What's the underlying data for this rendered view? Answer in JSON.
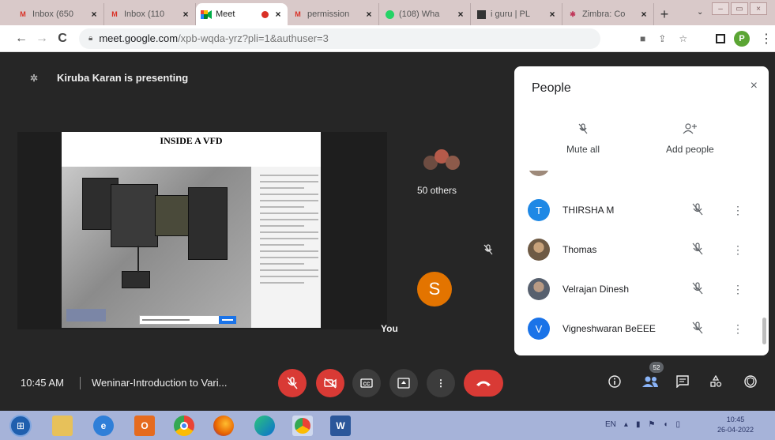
{
  "browser": {
    "tabs": [
      {
        "title": "Inbox (650",
        "favicon": "gmail-icon"
      },
      {
        "title": "Inbox (110",
        "favicon": "gmail-icon"
      },
      {
        "title": "Meet",
        "favicon": "meet-icon",
        "active": true,
        "recording": true
      },
      {
        "title": "permission",
        "favicon": "gmail-icon"
      },
      {
        "title": "(108) Wha",
        "favicon": "whatsapp-icon"
      },
      {
        "title": "i guru | PL",
        "favicon": "iguru-icon"
      },
      {
        "title": "Zimbra: Co",
        "favicon": "zimbra-icon"
      }
    ],
    "close_glyph": "×",
    "new_tab_glyph": "+",
    "tab_dropdown_glyph": "⌄",
    "window_buttons": [
      "–",
      "▭",
      "×"
    ],
    "nav": {
      "back": "←",
      "forward": "→",
      "reload": "C"
    },
    "url_host": "meet.google.com",
    "url_path": "/xpb-wqda-yrz?pli=1&authuser=3",
    "profile_initial": "P",
    "omnibox_icons": [
      "camera-icon",
      "share-icon",
      "star-icon"
    ]
  },
  "meet": {
    "presenter_text": "Kiruba Karan is presenting",
    "slide": {
      "title": "INSIDE A VFD"
    },
    "others_label": "50 others",
    "you_initial": "S",
    "you_label": "You",
    "colors": {
      "you_avatar": "#e37400",
      "danger": "#d93a35"
    }
  },
  "people_panel": {
    "title": "People",
    "close_glyph": "×",
    "actions": [
      {
        "label": "Mute all",
        "icon": "mic-off-icon"
      },
      {
        "label": "Add people",
        "icon": "add-person-icon"
      }
    ],
    "participants": [
      {
        "name": "",
        "avatar": "photo",
        "partial": true
      },
      {
        "name": "THIRSHA M",
        "avatar": "T",
        "avatar_color": "#1e88e5"
      },
      {
        "name": "Thomas",
        "avatar": "photo"
      },
      {
        "name": "Velrajan Dinesh",
        "avatar": "photo"
      },
      {
        "name": "Vigneshwaran BeEEE",
        "avatar": "V",
        "avatar_color": "#1a73e8"
      }
    ],
    "mute_glyph": "✕",
    "more_glyph": "⋮"
  },
  "controls": {
    "time": "10:45 AM",
    "meeting_title": "Weninar-Introduction to Vari...",
    "people_count": "52",
    "buttons": [
      "mic-off-icon",
      "camera-off-icon",
      "captions-icon",
      "present-icon",
      "more-options-icon",
      "end-call-icon"
    ],
    "right_icons": [
      "info-icon",
      "people-icon",
      "chat-icon",
      "activities-icon",
      "host-controls-icon"
    ]
  },
  "taskbar": {
    "apps": [
      "file-explorer-icon",
      "internet-explorer-icon",
      "outlook-icon",
      "chrome-icon",
      "firefox-icon",
      "edge-icon",
      "chrome-icon",
      "word-icon"
    ],
    "language": "EN",
    "time": "10:45",
    "date": "26-04-2022"
  }
}
